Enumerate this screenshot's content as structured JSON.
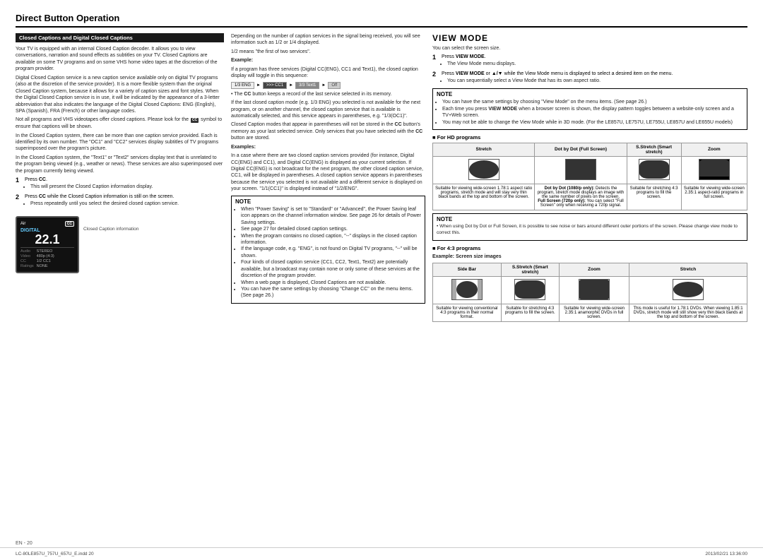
{
  "header": {
    "title": "Direct Button Operation"
  },
  "left_col": {
    "section_title": "Closed Captions and Digital Closed Captions",
    "paragraphs": [
      "Your TV is equipped with an internal Closed Caption decoder. It allows you to view conversations, narration and sound effects as subtitles on your TV. Closed Captions are available on some TV programs and on some VHS home video tapes at the discretion of the program provider.",
      "Digital Closed Caption service is a new caption service available only on digital TV programs (also at the discretion of the service provider). It is a more flexible system than the original Closed Caption system, because it allows for a variety of caption sizes and font styles. When the Digital Closed Caption service is in use, it will be indicated by the appearance of a 3-letter abbreviation that also indicates the language of the Digital Closed Captions: ENG (English), SPA (Spanish), FRA (French) or other language codes.",
      "Not all programs and VHS videotapes offer closed captions. Please look for the CC symbol to ensure that captions will be shown.",
      "In the Closed Caption system, there can be more than one caption service provided. Each is identified by its own number. The \"OC1\" and \"CC2\" services display subtitles of TV programs superimposed over the program's picture.",
      "In the Closed Caption system, the \"Text1\" or \"Text2\" services display text that is unrelated to the program being viewed (e.g., weather or news). These services are also superimposed over the program currently being viewed."
    ],
    "steps": [
      {
        "num": "1",
        "action": "Press CC.",
        "bullets": [
          "This will present the Closed Caption information display."
        ]
      },
      {
        "num": "2",
        "action": "Press CC while the Closed Caption information is still on the screen.",
        "bullets": [
          "Press repeatedly until you select the desired closed caption service."
        ]
      }
    ],
    "tv_display": {
      "air": "Air",
      "digital": "DIGITAL",
      "channel": "22.1",
      "audio_label": "Audio",
      "audio_val": "STEREO",
      "video_label": "Video",
      "video_val": "480p (4:3)",
      "cc_label": "CC",
      "cc_val": "1/2 CC1",
      "ratings_label": "Ratings",
      "ratings_val": "NONE",
      "caption_info": "Closed Caption information"
    }
  },
  "mid_col": {
    "para1": "Depending on the number of caption services in the signal being received, you will see information such as 1/2 or 1/4 displayed.",
    "para2": "1/2 means \"the first of two services\".",
    "example_label": "Example:",
    "example_para": "If a program has three services (Digital CC(ENG), CC1 and Text1), the closed caption display will toggle in this sequence:",
    "example_segs": [
      "1/3 ENG",
      ">>> CC1",
      "3/3 Text1",
      "Off"
    ],
    "para3": "The CC button keeps a record of the last service selected in its memory.",
    "para4": "If the last closed caption mode (e.g. 1/3 ENG) you selected is not available for the next program, or on another channel, the closed caption service that is available is automatically selected, and this service appears in parentheses, e.g. \"1/3(OC1)\".",
    "para5": "Closed Caption modes that appear in parentheses will not be stored in the CC button's memory as your last selected service. Only services that you have selected with the CC button are stored.",
    "examples_title": "Examples:",
    "examples_para": "In a case where there are two closed caption services provided (for instance, Digital CC(ENG) and CC1), and Digital CC(ENG) is displayed as your current selection. If Digital CC(ENG) is not broadcast for the next program, the other closed caption service, CC1, will be displayed in parentheses. A closed caption service appears in parentheses because the service you selected is not available and a different service is displayed on your screen. \"1/1(CC1)\" is displayed instead of \"1/2/ENG\".",
    "note": {
      "title": "NOTE",
      "bullets": [
        "When \"Power Saving\" is set to \"Standard\" or \"Advanced\", the Power Saving leaf icon appears on the channel information window. See page 26 for details of Power Saving settings.",
        "See page 27 for detailed closed caption settings.",
        "When the program contains no closed caption, \"--\" displays in the closed caption information.",
        "If the language code, e.g. \"ENG\", is not found on Digital TV programs, \"--\" will be shown.",
        "Four kinds of closed caption service (CC1, CC2, Text1, Text2) are potentially available, but a broadcast may contain none or only some of these services at the discretion of the program provider.",
        "When a web page is displayed, Closed Captions are not available.",
        "You can have the same settings by choosing \"Change CC\" on the menu items. (See page 26.)"
      ]
    }
  },
  "right_col": {
    "view_mode_title": "VIEW MODE",
    "intro": "You can select the screen size.",
    "steps": [
      {
        "num": "1",
        "text": "Press VIEW MODE.",
        "bullets": [
          "The View Mode menu displays."
        ]
      },
      {
        "num": "2",
        "text": "Press VIEW MODE or ▲/▼ while the View Mode menu is displayed to select a desired item on the menu.",
        "bullets": [
          "You can sequentially select a View Mode that has its own aspect ratio."
        ]
      }
    ],
    "note": {
      "title": "NOTE",
      "bullets": [
        "You can have the same settings by choosing \"View Mode\" on the menu items. (See page 26.)",
        "Each time you press VIEW MODE when a browser screen is shown, the display pattern toggles between a website-only screen and a TV+Web screen.",
        "You may not be able to change the View Mode while in 3D mode. (For the LE857U, LE757U, LE755U, LE857U and LE655U models)"
      ]
    },
    "hd_section": {
      "title": "■ For HD programs",
      "columns": [
        "Stretch",
        "Dot by Dot (Full Screen)",
        "S.Stretch (Smart stretch)",
        "Zoom"
      ],
      "rows": [
        {
          "type": "screen",
          "screens": [
            "wide",
            "dotbydot",
            "smart",
            "zoom-hd"
          ]
        },
        {
          "descriptions": [
            "Suitable for viewing wide-screen 1.78:1 aspect ratio programs, stretch mode and will stay very thin black bands at the top and bottom of the screen.",
            "Dot by Dot (1080/p only): Detects the program, stretch mode displays an image with the same number of pixels on the screen.\nFull Screen (720p only): You can select \"Full Screen\" only when receiving a 720p signal.",
            "Suitable for stretching 4:3 programs to fill the screen.",
            "Suitable for viewing wide-screen 2.35:1 aspect-ratio programs in full screen."
          ]
        }
      ]
    },
    "note2": {
      "title": "NOTE",
      "text": "When using Dot by Dot or Full Screen, it is possible to see noise or bars around different outer portions of the screen. Please change view mode to correct this."
    },
    "four3_section": {
      "title": "■ For 4:3 programs",
      "example_title": "Example: Screen size images",
      "columns": [
        "Side Bar",
        "S.Stretch (Smart stretch)",
        "Zoom",
        "Stretch"
      ],
      "descriptions": [
        "Suitable for viewing conventional 4:3 programs in their normal format.",
        "Suitable for stretching 4:3 programs to fill the screen.",
        "Suitable for viewing wide-screen 2.35:1 anamorphic DVDs in full screen.",
        "This mode is useful for 1.78:1 DVDs. When viewing 1.85:1 DVDs, stretch mode will still show very thin black bands at the top and bottom of the screen."
      ]
    }
  },
  "footer": {
    "file_info": "LC-80LE857U_757U_657U_E.indd 20",
    "page_num": "20",
    "date": "2013/02/21  13:36:00",
    "en_marker": "EN - 20"
  }
}
